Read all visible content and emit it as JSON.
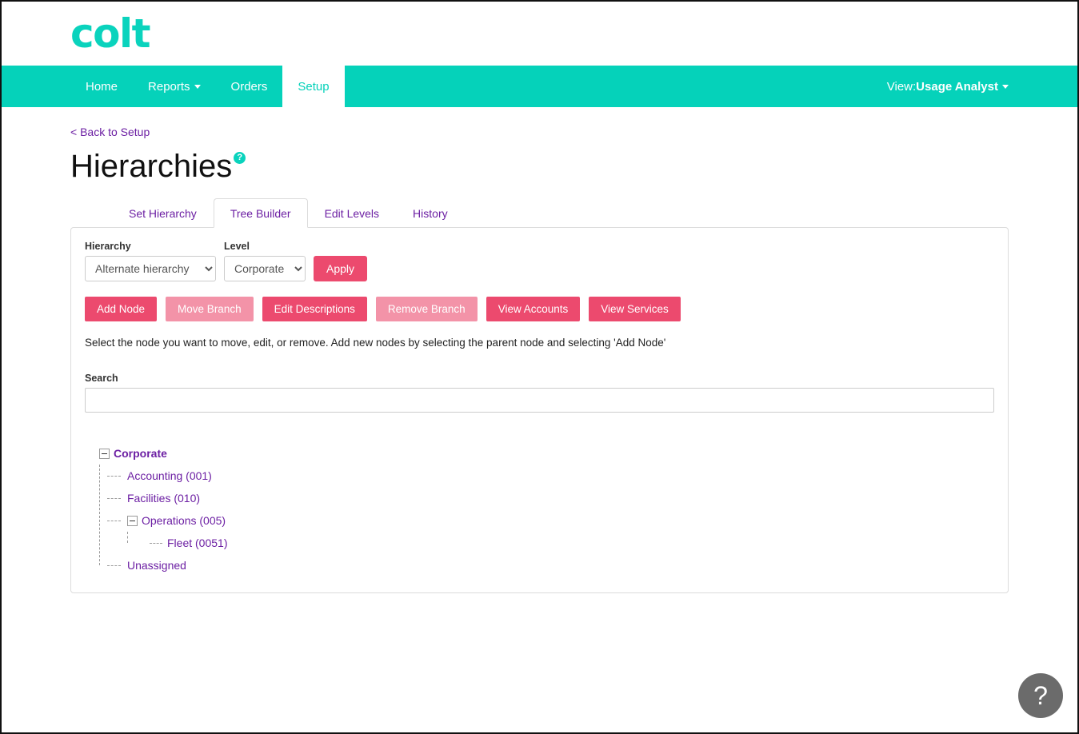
{
  "brand": {
    "logo_text": "colt"
  },
  "nav": {
    "items": [
      {
        "label": "Home",
        "has_caret": false,
        "active": false
      },
      {
        "label": "Reports",
        "has_caret": true,
        "active": false
      },
      {
        "label": "Orders",
        "has_caret": false,
        "active": false
      },
      {
        "label": "Setup",
        "has_caret": false,
        "active": true
      }
    ],
    "view_prefix": "View: ",
    "view_value": "Usage Analyst"
  },
  "breadcrumb": {
    "back_label": "< Back to Setup"
  },
  "header": {
    "title": "Hierarchies",
    "help_badge": "?"
  },
  "tabs": [
    {
      "label": "Set Hierarchy",
      "active": false
    },
    {
      "label": "Tree Builder",
      "active": true
    },
    {
      "label": "Edit Levels",
      "active": false
    },
    {
      "label": "History",
      "active": false
    }
  ],
  "form": {
    "hierarchy_label": "Hierarchy",
    "hierarchy_value": "Alternate hierarchy",
    "hierarchy_options": [
      "Alternate hierarchy"
    ],
    "level_label": "Level",
    "level_value": "Corporate",
    "level_options": [
      "Corporate"
    ],
    "apply_label": "Apply"
  },
  "actions": [
    {
      "label": "Add Node",
      "disabled": false
    },
    {
      "label": "Move Branch",
      "disabled": true
    },
    {
      "label": "Edit Descriptions",
      "disabled": false
    },
    {
      "label": "Remove Branch",
      "disabled": true
    },
    {
      "label": "View Accounts",
      "disabled": false
    },
    {
      "label": "View Services",
      "disabled": false
    }
  ],
  "hint": "Select the node you want to move, edit, or remove. Add new nodes by selecting the parent node and selecting 'Add Node'",
  "search": {
    "label": "Search",
    "value": "",
    "placeholder": ""
  },
  "tree": {
    "root": {
      "label": "Corporate",
      "expanded": true
    },
    "children": [
      {
        "label": "Accounting (001)",
        "toggle": false
      },
      {
        "label": "Facilities (010)",
        "toggle": false
      },
      {
        "label": "Operations (005)",
        "toggle": true,
        "expanded": true
      },
      {
        "label": "Unassigned",
        "toggle": false
      }
    ],
    "grandchild": {
      "label": "Fleet (0051)"
    }
  },
  "help_fab": {
    "glyph": "?"
  },
  "colors": {
    "teal": "#05d2ba",
    "pink": "#ec4a6e",
    "pink_disabled": "#f393a8",
    "link_purple": "#6c1fa3",
    "fab_gray": "#6b6b6b"
  }
}
